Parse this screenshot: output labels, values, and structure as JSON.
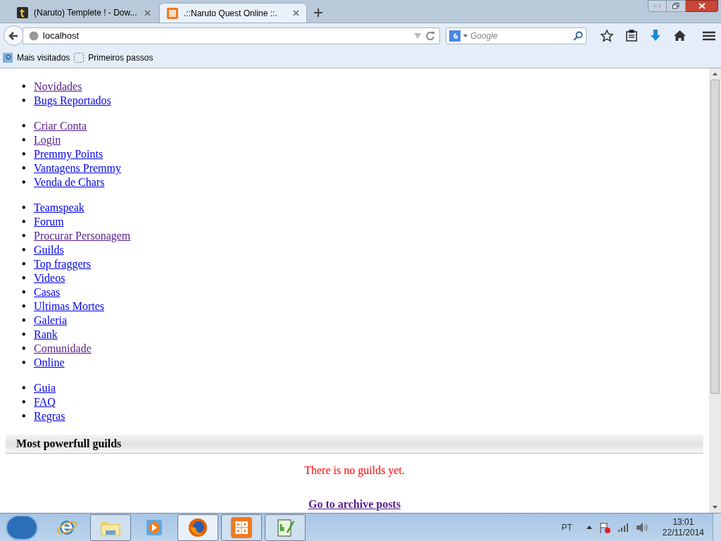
{
  "tabs": [
    {
      "title": "(Naruto) Templete ! - Dow...",
      "kind": "t",
      "selected": false
    },
    {
      "title": ".::Naruto Quest Online ::.",
      "kind": "xampp",
      "selected": true
    }
  ],
  "address_bar": {
    "value": "localhost"
  },
  "search": {
    "placeholder": "Google"
  },
  "bookmarks": [
    {
      "label": "Mais visitados",
      "kind": "most"
    },
    {
      "label": "Primeiros passos",
      "kind": "first"
    }
  ],
  "nav_groups": [
    [
      {
        "marker": "•",
        "label": "Novidades",
        "visited": true
      },
      {
        "marker": "•",
        "label": "Bugs Reportados",
        "visited": false
      }
    ],
    [
      {
        "marker": "•",
        "label": "Criar Conta",
        "visited": true
      },
      {
        "marker": "•",
        "label": "Login",
        "visited": true
      },
      {
        "marker": "•",
        "label": "Premmy Points",
        "visited": false
      },
      {
        "marker": "•",
        "label": "Vantagens Premmy",
        "visited": false
      },
      {
        "marker": "•",
        "label": "Venda de Chars",
        "visited": false
      }
    ],
    [
      {
        "marker": "•",
        "label": "Teamspeak",
        "visited": false
      },
      {
        "marker": "•",
        "label": "Forum",
        "visited": false
      },
      {
        "marker": "•",
        "label": "Procurar Personagem",
        "visited": true
      },
      {
        "marker": "•",
        "label": "Guilds",
        "visited": false
      },
      {
        "marker": "•",
        "label": "Top fraggers",
        "visited": false
      },
      {
        "marker": "•",
        "label": "Videos",
        "visited": false
      },
      {
        "marker": "•",
        "label": "Casas",
        "visited": false
      },
      {
        "marker": "•",
        "label": "Ultimas Mortes",
        "visited": false
      },
      {
        "marker": "•",
        "label": "Galeria",
        "visited": false
      },
      {
        "marker": "•",
        "label": "Rank",
        "visited": false
      },
      {
        "marker": "•",
        "label": "Comunidade",
        "visited": true
      },
      {
        "marker": "•",
        "label": "Online",
        "visited": false
      }
    ],
    [
      {
        "marker": "•",
        "label": "Guia",
        "visited": false
      },
      {
        "marker": "•",
        "label": "FAQ",
        "visited": false
      },
      {
        "marker": "•",
        "label": "Regras",
        "visited": false
      }
    ]
  ],
  "guilds_panel": {
    "title": "Most powerfull guilds",
    "message": "There is no guilds yet."
  },
  "archive_link": {
    "label": "Go to archive posts",
    "visited": true
  },
  "taskbar": {
    "apps": [
      {
        "kind": "ie",
        "running": false,
        "selected": false
      },
      {
        "kind": "explorer",
        "running": true,
        "selected": false
      },
      {
        "kind": "media",
        "running": false,
        "selected": false
      },
      {
        "kind": "firefox",
        "running": true,
        "selected": true
      },
      {
        "kind": "xampp",
        "running": true,
        "selected": false
      },
      {
        "kind": "notepad",
        "running": true,
        "selected": false
      }
    ],
    "language": "PT",
    "time": "13:01",
    "date": "22/11/2014"
  }
}
